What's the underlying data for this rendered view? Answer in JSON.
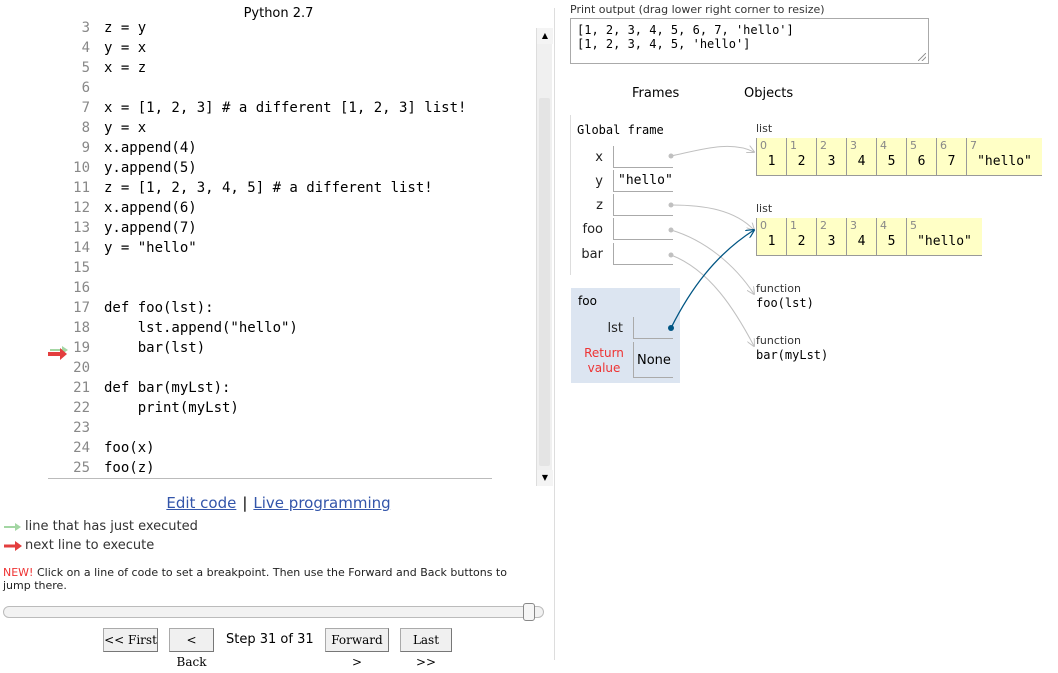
{
  "language": "Python 2.7",
  "code_lines": [
    {
      "n": "3",
      "text": "z = y"
    },
    {
      "n": "4",
      "text": "y = x"
    },
    {
      "n": "5",
      "text": "x = z"
    },
    {
      "n": "6",
      "text": ""
    },
    {
      "n": "7",
      "text": "x = [1, 2, 3] # a different [1, 2, 3] list!"
    },
    {
      "n": "8",
      "text": "y = x"
    },
    {
      "n": "9",
      "text": "x.append(4)"
    },
    {
      "n": "10",
      "text": "y.append(5)"
    },
    {
      "n": "11",
      "text": "z = [1, 2, 3, 4, 5] # a different list!"
    },
    {
      "n": "12",
      "text": "x.append(6)"
    },
    {
      "n": "13",
      "text": "y.append(7)"
    },
    {
      "n": "14",
      "text": "y = \"hello\""
    },
    {
      "n": "15",
      "text": ""
    },
    {
      "n": "16",
      "text": ""
    },
    {
      "n": "17",
      "text": "def foo(lst):"
    },
    {
      "n": "18",
      "text": "    lst.append(\"hello\")"
    },
    {
      "n": "19",
      "text": "    bar(lst)"
    },
    {
      "n": "20",
      "text": ""
    },
    {
      "n": "21",
      "text": "def bar(myLst):"
    },
    {
      "n": "22",
      "text": "    print(myLst)"
    },
    {
      "n": "23",
      "text": ""
    },
    {
      "n": "24",
      "text": "foo(x)"
    },
    {
      "n": "25",
      "text": "foo(z)"
    }
  ],
  "edit_links": {
    "edit": "Edit code",
    "separator": "|",
    "live": "Live programming"
  },
  "legend": {
    "executed": "line that has just executed",
    "next": "next line to execute",
    "executed_color": "#a3d6a3",
    "next_color": "#e33e3e"
  },
  "breakpoint_note": {
    "new_tag": "NEW!",
    "text": " Click on a line of code to set a breakpoint. Then use the Forward and Back buttons to jump there."
  },
  "step_slider": {
    "value": 1.0
  },
  "nav": {
    "first": "<< First",
    "back": "< Back",
    "step": "Step 31 of 31",
    "forward": "Forward >",
    "last": "Last >>"
  },
  "print_output": {
    "caption": "Print output (drag lower right corner to resize)",
    "lines": [
      "[1, 2, 3, 4, 5, 6, 7, 'hello']",
      "[1, 2, 3, 4, 5, 'hello']"
    ]
  },
  "headers": {
    "frames": "Frames",
    "objects": "Objects"
  },
  "global_frame": {
    "title": "Global frame",
    "vars": [
      {
        "name": "x",
        "value": ""
      },
      {
        "name": "y",
        "value": "\"hello\""
      },
      {
        "name": "z",
        "value": ""
      },
      {
        "name": "foo",
        "value": ""
      },
      {
        "name": "bar",
        "value": ""
      }
    ]
  },
  "foo_frame": {
    "title": "foo",
    "var_name": "lst",
    "return_label": "Return value",
    "return_value": "None",
    "highlight_color": "#dce5f1"
  },
  "objects": {
    "list1": {
      "label": "list",
      "indices": [
        "0",
        "1",
        "2",
        "3",
        "4",
        "5",
        "6",
        "7"
      ],
      "values": [
        "1",
        "2",
        "3",
        "4",
        "5",
        "6",
        "7",
        "\"hello\""
      ]
    },
    "list2": {
      "label": "list",
      "indices": [
        "0",
        "1",
        "2",
        "3",
        "4",
        "5"
      ],
      "values": [
        "1",
        "2",
        "3",
        "4",
        "5",
        "\"hello\""
      ]
    },
    "fn_foo": {
      "kind": "function",
      "sig": "foo(lst)"
    },
    "fn_bar": {
      "kind": "function",
      "sig": "bar(myLst)"
    },
    "list_color": "#ffffc6"
  },
  "pointer_color": "#005583",
  "pointer_inactive_color": "#c0c0c0"
}
